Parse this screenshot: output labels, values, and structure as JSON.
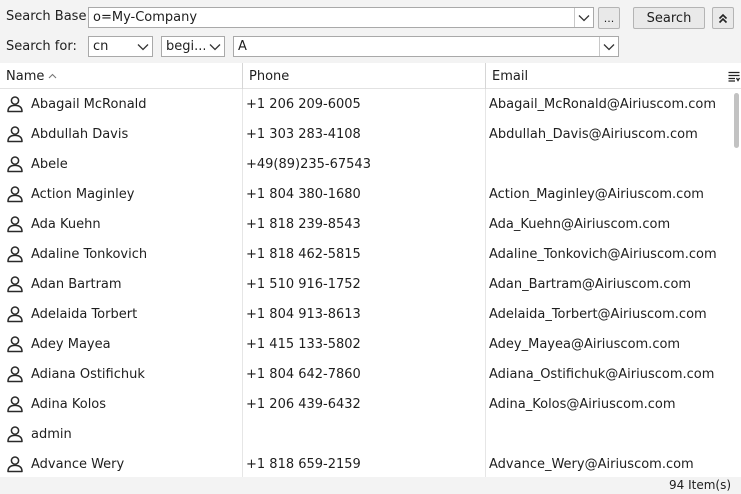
{
  "search": {
    "base_label": "Search Base:",
    "base_value": "o=My-Company",
    "browse_label": "...",
    "search_button": "Search",
    "for_label": "Search for:",
    "attribute_value": "cn",
    "operator_value": "begi...",
    "term_value": "A"
  },
  "table": {
    "columns": [
      "Name",
      "Phone",
      "Email"
    ],
    "rows": [
      {
        "name": "Abagail McRonald",
        "phone": "+1 206 209-6005",
        "email": "Abagail_McRonald@Airiuscom.com"
      },
      {
        "name": "Abdullah Davis",
        "phone": "+1 303 283-4108",
        "email": "Abdullah_Davis@Airiuscom.com"
      },
      {
        "name": "Abele",
        "phone": "+49(89)235-67543",
        "email": ""
      },
      {
        "name": "Action Maginley",
        "phone": "+1 804 380-1680",
        "email": "Action_Maginley@Airiuscom.com"
      },
      {
        "name": "Ada Kuehn",
        "phone": "+1 818 239-8543",
        "email": "Ada_Kuehn@Airiuscom.com"
      },
      {
        "name": "Adaline Tonkovich",
        "phone": "+1 818 462-5815",
        "email": "Adaline_Tonkovich@Airiuscom.com"
      },
      {
        "name": "Adan Bartram",
        "phone": "+1 510 916-1752",
        "email": "Adan_Bartram@Airiuscom.com"
      },
      {
        "name": "Adelaida Torbert",
        "phone": "+1 804 913-8613",
        "email": "Adelaida_Torbert@Airiuscom.com"
      },
      {
        "name": "Adey Mayea",
        "phone": "+1 415 133-5802",
        "email": "Adey_Mayea@Airiuscom.com"
      },
      {
        "name": "Adiana Ostifichuk",
        "phone": "+1 804 642-7860",
        "email": "Adiana_Ostifichuk@Airiuscom.com"
      },
      {
        "name": "Adina Kolos",
        "phone": "+1 206 439-6432",
        "email": "Adina_Kolos@Airiuscom.com"
      },
      {
        "name": "admin",
        "phone": "",
        "email": ""
      },
      {
        "name": "Advance Wery",
        "phone": "+1 818 659-2159",
        "email": "Advance_Wery@Airiuscom.com"
      }
    ],
    "row_icon": "person-icon",
    "sort_icon": "sort-ascending-icon",
    "column_menu_icon": "column-chooser-icon"
  },
  "status": {
    "count": "94 Item(s)"
  }
}
